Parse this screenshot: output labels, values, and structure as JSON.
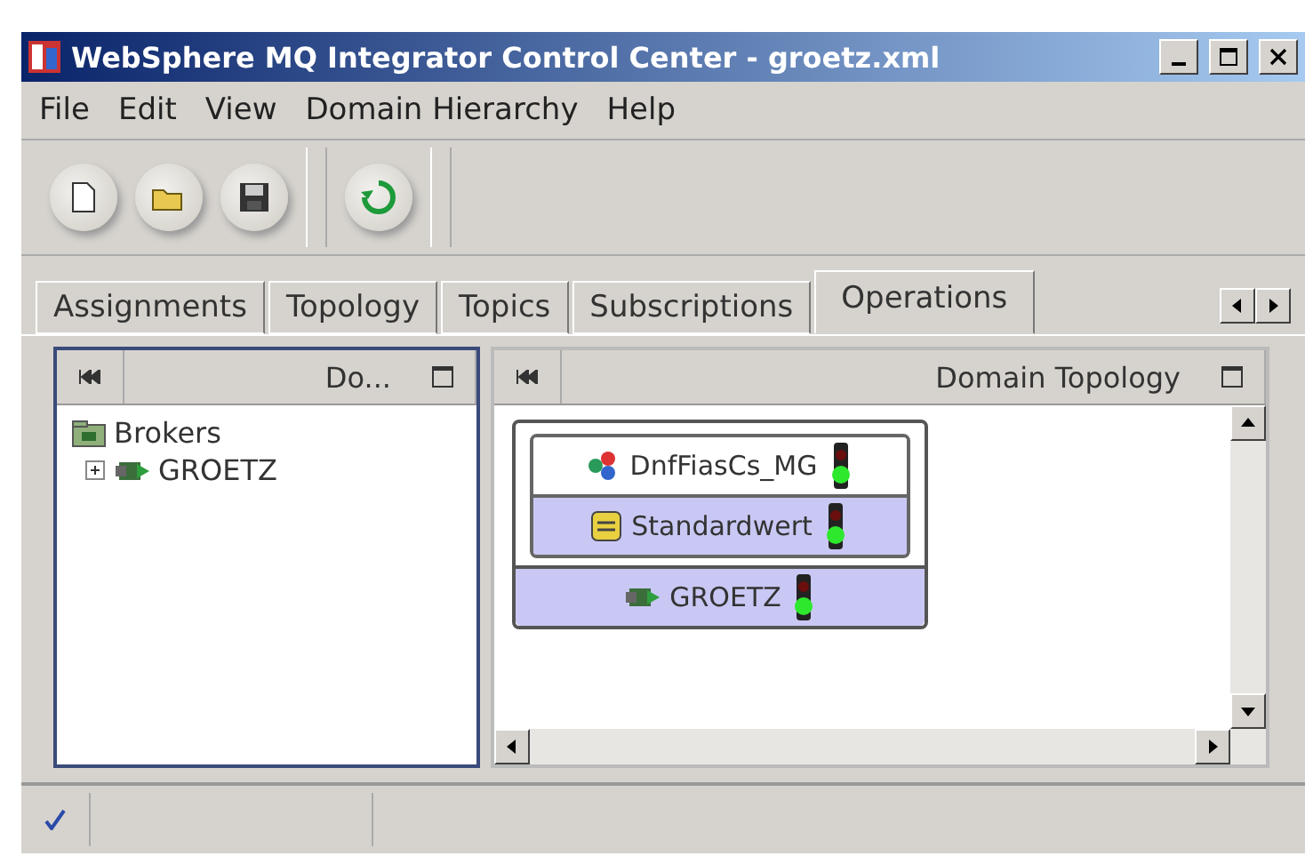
{
  "window": {
    "title": "WebSphere MQ Integrator Control Center - groetz.xml"
  },
  "menu": [
    "File",
    "Edit",
    "View",
    "Domain Hierarchy",
    "Help"
  ],
  "tabs": [
    {
      "label": "Assignments",
      "selected": false
    },
    {
      "label": "Topology",
      "selected": false
    },
    {
      "label": "Topics",
      "selected": false
    },
    {
      "label": "Subscriptions",
      "selected": false
    },
    {
      "label": "Operations",
      "selected": true
    }
  ],
  "left_pane": {
    "title": "Do...",
    "tree": [
      {
        "label": "Brokers",
        "kind": "folder",
        "children": [
          {
            "label": "GROETZ",
            "kind": "broker",
            "expanded": false
          }
        ]
      }
    ]
  },
  "right_pane": {
    "title": "Domain Topology",
    "broker": {
      "label": "GROETZ",
      "running": true,
      "execution_group": {
        "label": "Standardwert",
        "running": true
      },
      "message_flow": {
        "label": "DnfFiasCs_MG",
        "running": true
      }
    }
  }
}
